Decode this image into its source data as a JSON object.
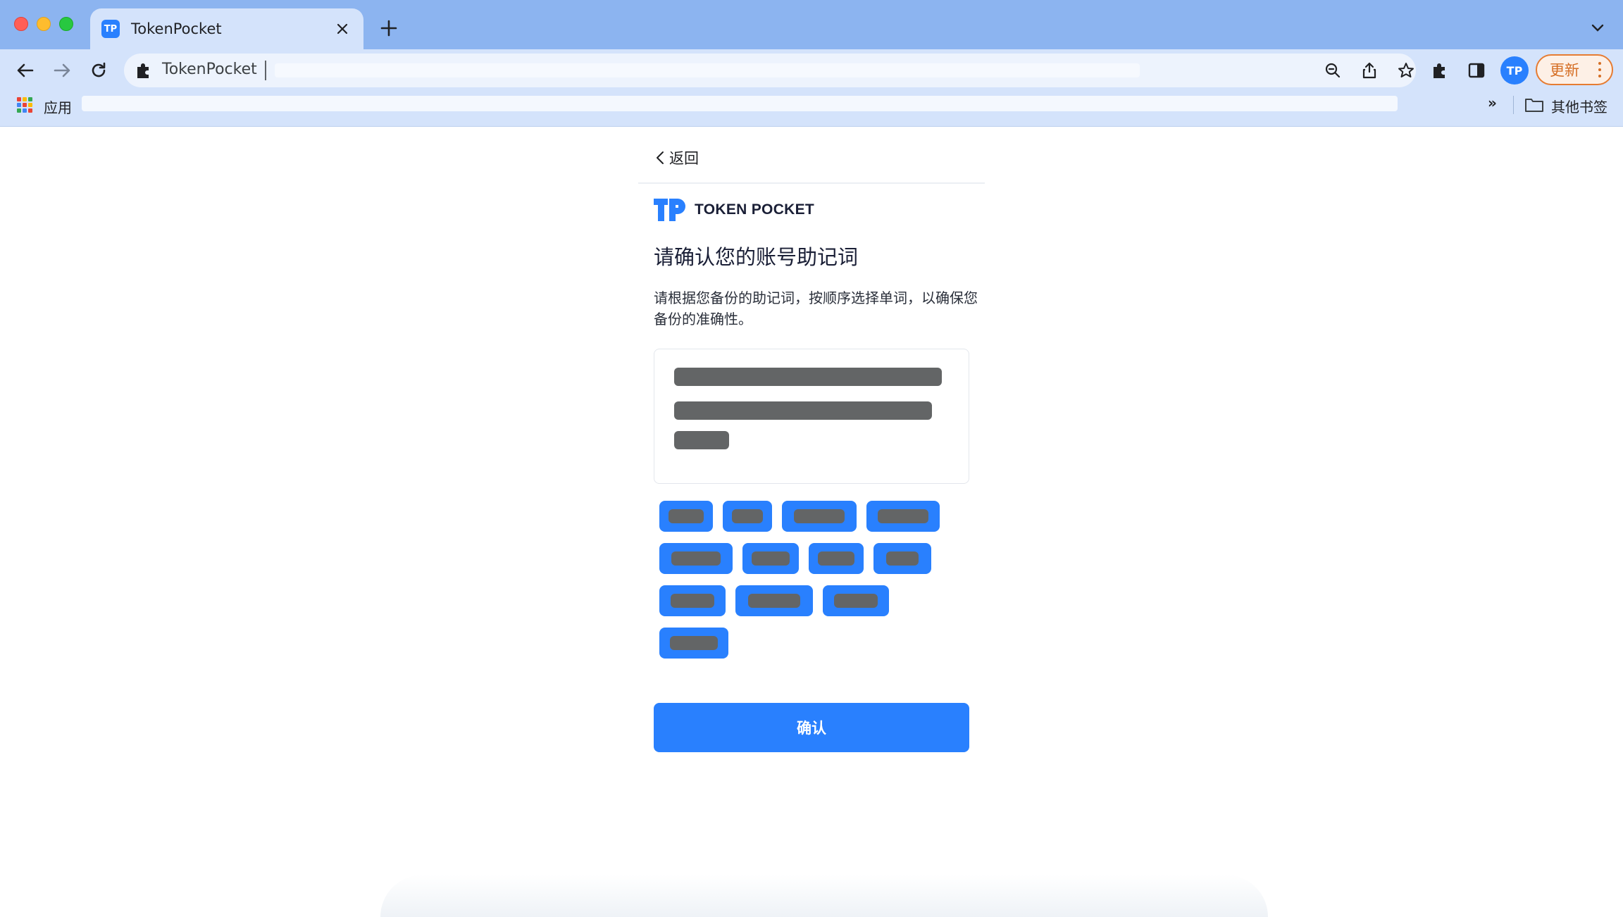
{
  "browser": {
    "tab": {
      "favicon": "TP",
      "title": "TokenPocket"
    },
    "omnibox": {
      "site_label": "TokenPocket"
    },
    "profile_initials": "TP",
    "update_label": "更新",
    "bookmarks": {
      "apps_label": "应用",
      "overflow_label": "»",
      "other_label": "其他书签"
    },
    "icons": [
      "back-arrow-icon",
      "forward-arrow-icon",
      "reload-icon",
      "puzzle-icon",
      "zoom-icon",
      "share-icon",
      "star-icon",
      "extensions-icon",
      "sidepanel-icon",
      "apps-grid-icon",
      "folder-icon",
      "close-icon",
      "plus-icon",
      "chevron-down-icon"
    ]
  },
  "page": {
    "back_label": "返回",
    "logo_text": "TOKEN POCKET",
    "title": "请确认您的账号助记词",
    "description": "请根据您备份的助记词，按顺序选择单词，以确保您备份的准确性。",
    "phrase_lines_redacted": 3,
    "word_chips_redacted": 12,
    "confirm_label": "确认"
  },
  "colors": {
    "brand_blue": "#2980fe",
    "chrome_blue": "#8cb4f0",
    "toolbar": "#d4e3fb",
    "redaction": "#636566",
    "update_orange": "#d56e24"
  }
}
